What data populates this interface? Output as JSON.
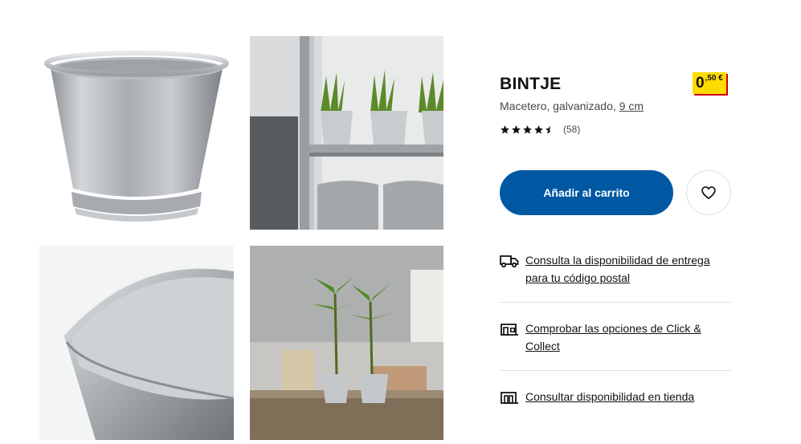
{
  "product": {
    "name": "BINTJE",
    "description": "Macetero, galvanizado,",
    "size_link": "9 cm",
    "price_integer": "0",
    "price_decimal": ",50 €",
    "rating": 4.5,
    "rating_count": "(58)"
  },
  "actions": {
    "add_to_cart": "Añadir al carrito",
    "favorite_icon": "heart-icon"
  },
  "availability_links": [
    {
      "icon": "delivery-truck-icon",
      "label": "Consulta la disponibilidad de entrega para tu código postal"
    },
    {
      "icon": "click-collect-store-icon",
      "label": "Comprobar las opciones de Click & Collect"
    },
    {
      "icon": "store-icon",
      "label": "Consultar disponibilidad en tienda"
    }
  ],
  "gallery": [
    {
      "name": "product-image-pot"
    },
    {
      "name": "product-image-shelf-plants"
    },
    {
      "name": "product-image-pot-closeup"
    },
    {
      "name": "product-image-bamboo-table"
    }
  ],
  "colors": {
    "cart_button": "#0058a3",
    "price_tag": "#ffdb00",
    "price_shadow": "#cc0008"
  }
}
